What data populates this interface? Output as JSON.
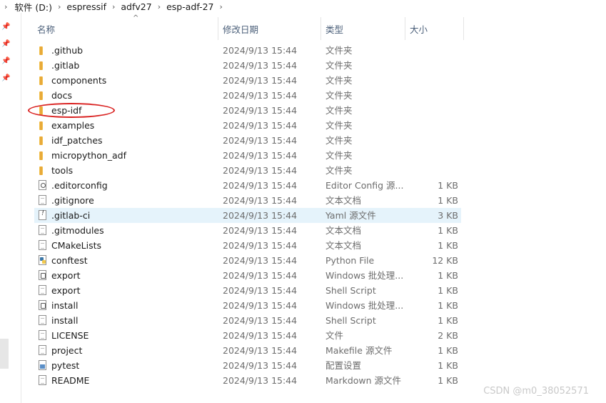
{
  "breadcrumb": {
    "items": [
      "软件 (D:)",
      "espressif",
      "adfv27",
      "esp-adf-27"
    ]
  },
  "columns": {
    "name": "名称",
    "date": "修改日期",
    "type": "类型",
    "size": "大小"
  },
  "rows": [
    {
      "name": ".github",
      "date": "2024/9/13 15:44",
      "type": "文件夹",
      "size": "",
      "icon": "folder-icon"
    },
    {
      "name": ".gitlab",
      "date": "2024/9/13 15:44",
      "type": "文件夹",
      "size": "",
      "icon": "folder-icon"
    },
    {
      "name": "components",
      "date": "2024/9/13 15:44",
      "type": "文件夹",
      "size": "",
      "icon": "folder-icon"
    },
    {
      "name": "docs",
      "date": "2024/9/13 15:44",
      "type": "文件夹",
      "size": "",
      "icon": "folder-icon"
    },
    {
      "name": "esp-idf",
      "date": "2024/9/13 15:44",
      "type": "文件夹",
      "size": "",
      "icon": "folder-icon"
    },
    {
      "name": "examples",
      "date": "2024/9/13 15:44",
      "type": "文件夹",
      "size": "",
      "icon": "folder-icon"
    },
    {
      "name": "idf_patches",
      "date": "2024/9/13 15:44",
      "type": "文件夹",
      "size": "",
      "icon": "folder-icon"
    },
    {
      "name": "micropython_adf",
      "date": "2024/9/13 15:44",
      "type": "文件夹",
      "size": "",
      "icon": "folder-icon"
    },
    {
      "name": "tools",
      "date": "2024/9/13 15:44",
      "type": "文件夹",
      "size": "",
      "icon": "folder-icon"
    },
    {
      "name": ".editorconfig",
      "date": "2024/9/13 15:44",
      "type": "Editor Config 源...",
      "size": "1 KB",
      "icon": "gear-file-icon"
    },
    {
      "name": ".gitignore",
      "date": "2024/9/13 15:44",
      "type": "文本文档",
      "size": "1 KB",
      "icon": "file-icon"
    },
    {
      "name": ".gitlab-ci",
      "date": "2024/9/13 15:44",
      "type": "Yaml 源文件",
      "size": "3 KB",
      "icon": "yaml-file-icon"
    },
    {
      "name": ".gitmodules",
      "date": "2024/9/13 15:44",
      "type": "文本文档",
      "size": "1 KB",
      "icon": "file-icon"
    },
    {
      "name": "CMakeLists",
      "date": "2024/9/13 15:44",
      "type": "文本文档",
      "size": "1 KB",
      "icon": "file-icon"
    },
    {
      "name": "conftest",
      "date": "2024/9/13 15:44",
      "type": "Python File",
      "size": "12 KB",
      "icon": "py-file-icon"
    },
    {
      "name": "export",
      "date": "2024/9/13 15:44",
      "type": "Windows 批处理...",
      "size": "1 KB",
      "icon": "bat-file-icon"
    },
    {
      "name": "export",
      "date": "2024/9/13 15:44",
      "type": "Shell Script",
      "size": "1 KB",
      "icon": "file-icon"
    },
    {
      "name": "install",
      "date": "2024/9/13 15:44",
      "type": "Windows 批处理...",
      "size": "1 KB",
      "icon": "bat-file-icon"
    },
    {
      "name": "install",
      "date": "2024/9/13 15:44",
      "type": "Shell Script",
      "size": "1 KB",
      "icon": "file-icon"
    },
    {
      "name": "LICENSE",
      "date": "2024/9/13 15:44",
      "type": "文件",
      "size": "2 KB",
      "icon": "file-icon"
    },
    {
      "name": "project",
      "date": "2024/9/13 15:44",
      "type": "Makefile 源文件",
      "size": "1 KB",
      "icon": "file-icon"
    },
    {
      "name": "pytest",
      "date": "2024/9/13 15:44",
      "type": "配置设置",
      "size": "1 KB",
      "icon": "cfg-file-icon"
    },
    {
      "name": "README",
      "date": "2024/9/13 15:44",
      "type": "Markdown 源文件",
      "size": "1 KB",
      "icon": "file-icon"
    }
  ],
  "selected_row_index": 11,
  "highlighted_row_index": 4,
  "watermark": "CSDN @m0_38052571",
  "colors": {
    "selection": "#e5f3fb",
    "highlight_ellipse": "#d9201f",
    "folder": "#f2c04c"
  }
}
